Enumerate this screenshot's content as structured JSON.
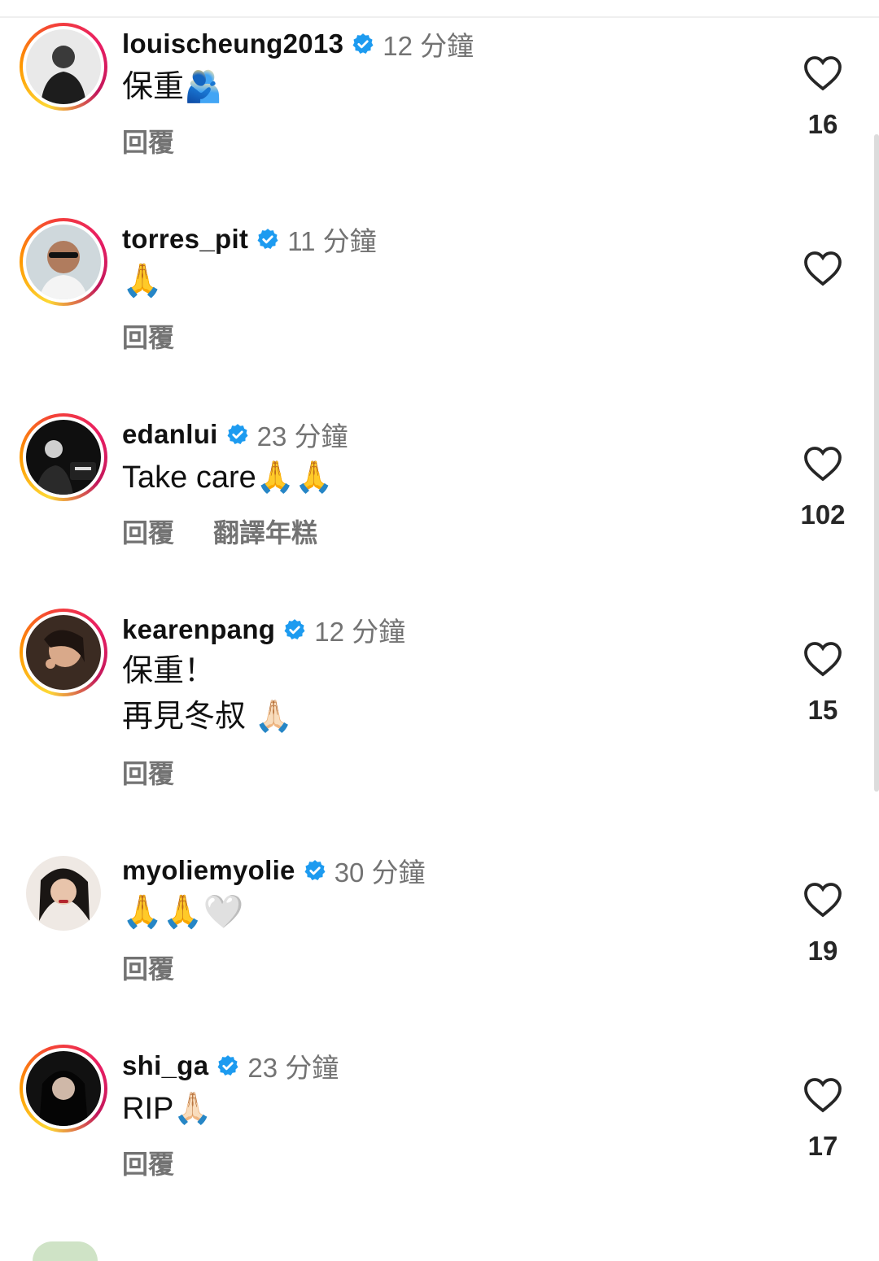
{
  "comments": [
    {
      "username": "louischeung2013",
      "time": "12 分鐘",
      "lines": [
        "保重🫂"
      ],
      "actions": [
        "回覆"
      ],
      "likes": "16",
      "ring": true
    },
    {
      "username": "torres_pit",
      "time": "11 分鐘",
      "lines": [
        "🙏"
      ],
      "actions": [
        "回覆"
      ],
      "likes": "",
      "ring": true
    },
    {
      "username": "edanlui",
      "time": "23 分鐘",
      "lines": [
        "Take care🙏🙏"
      ],
      "actions": [
        "回覆",
        "翻譯年糕"
      ],
      "likes": "102",
      "ring": true
    },
    {
      "username": "kearenpang",
      "time": "12 分鐘",
      "lines": [
        "保重！",
        "再見冬叔 🙏🏻"
      ],
      "actions": [
        "回覆"
      ],
      "likes": "15",
      "ring": true
    },
    {
      "username": "myoliemyolie",
      "time": "30 分鐘",
      "lines": [
        "🙏🙏🤍"
      ],
      "actions": [
        "回覆"
      ],
      "likes": "19",
      "ring": false
    },
    {
      "username": "shi_ga",
      "time": "23 分鐘",
      "lines": [
        "RIP🙏🏻"
      ],
      "actions": [
        "回覆"
      ],
      "likes": "17",
      "ring": true
    }
  ],
  "colors": {
    "verified": "#1d9bf0",
    "muted": "#737373",
    "text": "#111111"
  },
  "icons": {
    "verified": "verified-badge-icon",
    "like": "heart-outline-icon"
  }
}
